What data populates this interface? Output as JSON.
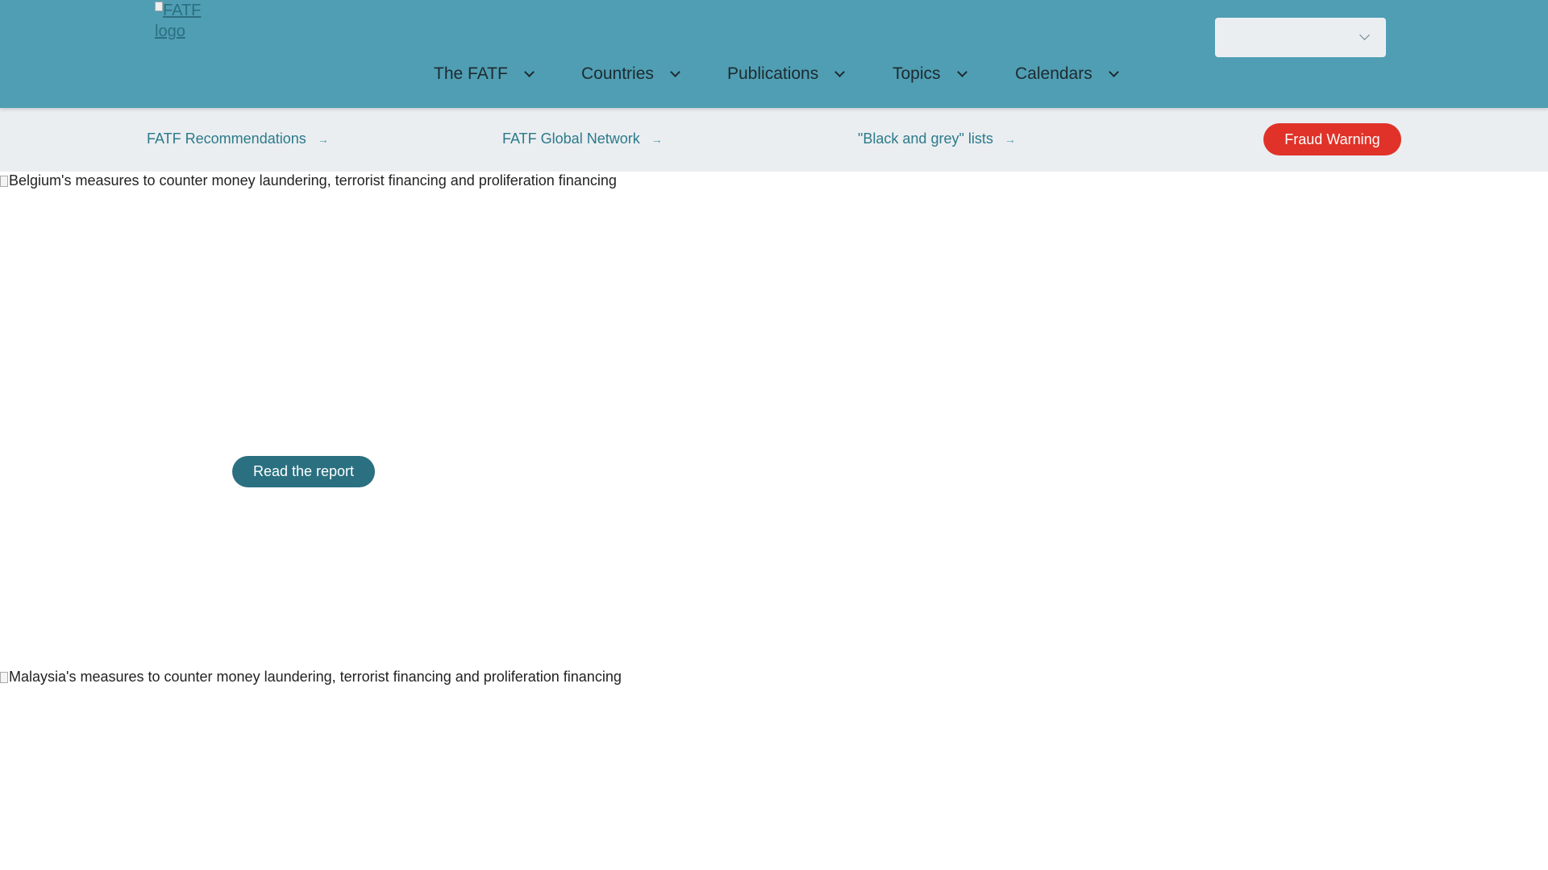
{
  "header": {
    "logo_alt": "FATF logo",
    "nav": [
      "The FATF",
      "Countries",
      "Publications",
      "Topics",
      "Calendars"
    ],
    "language_select_value": ""
  },
  "subnav": {
    "links": [
      "FATF Recommendations",
      "FATF Global Network",
      "\"Black and grey\" lists"
    ],
    "fraud_warning": "Fraud Warning"
  },
  "slides": [
    {
      "image_alt": "Belgium's measures to counter money laundering, terrorist financing and proliferation financing",
      "button": "Read the report"
    },
    {
      "image_alt": "Malaysia's measures to counter money laundering, terrorist financing and proliferation financing"
    }
  ],
  "colors": {
    "header": "#509eb3",
    "subnav": "#ebeef1",
    "accent": "#2b7a8a",
    "fraud": "#e03228",
    "button": "#2a7080"
  }
}
